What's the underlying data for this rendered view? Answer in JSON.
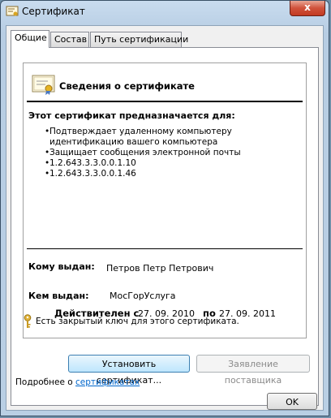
{
  "window": {
    "title": "Сертификат",
    "close_label": "x"
  },
  "tabs": [
    {
      "label": "Общие",
      "active": true
    },
    {
      "label": "Состав",
      "active": false
    },
    {
      "label": "Путь сертификации",
      "active": false
    }
  ],
  "cert": {
    "title": "Сведения о сертификате",
    "purpose_heading": "Этот сертификат предназначается для:",
    "purposes": [
      "Подтверждает удаленному компьютеру идентификацию вашего компьютера",
      "Защищает сообщения электронной почты",
      "1.2.643.3.3.0.0.1.10",
      "1.2.643.3.3.0.0.1.46"
    ],
    "issued_to_label": "Кому выдан:",
    "issued_to_value": "Петров Петр Петрович",
    "issued_by_label": "Кем выдан:",
    "issued_by_value": "МосГорУслуга",
    "valid_from_label": "Действителен с",
    "valid_from_value": "27. 09. 2010",
    "valid_to_label": "по",
    "valid_to_value": "27. 09. 2011",
    "private_key_text": "Есть закрытый ключ для этого сертификата."
  },
  "buttons": {
    "install": "Установить сертификат...",
    "issuer_statement": "Заявление поставщика",
    "ok": "OK"
  },
  "more": {
    "prefix": "Подробнее о ",
    "link": "сертификатах"
  },
  "colors": {
    "link": "#0066cc",
    "close": "#c23a22",
    "key": "#d4a017"
  }
}
